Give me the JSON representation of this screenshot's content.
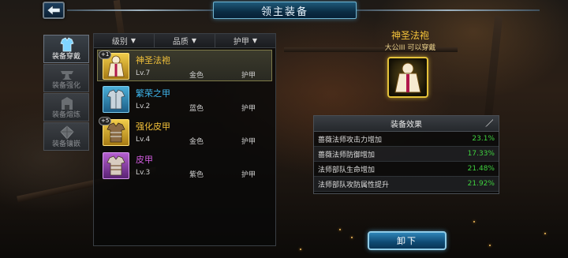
{
  "header": {
    "title": "领主装备",
    "back_icon": "back-arrow-icon"
  },
  "side_tabs": [
    {
      "label": "装备穿戴",
      "icon": "armor-icon",
      "active": true
    },
    {
      "label": "装备强化",
      "icon": "anvil-icon",
      "active": false
    },
    {
      "label": "装备熔炼",
      "icon": "furnace-icon",
      "active": false
    },
    {
      "label": "装备镶嵌",
      "icon": "gem-icon",
      "active": false
    }
  ],
  "filters": [
    {
      "label": "级别",
      "icon": "dropdown-triangle-icon"
    },
    {
      "label": "品质",
      "icon": "dropdown-triangle-icon"
    },
    {
      "label": "护甲",
      "icon": "dropdown-triangle-icon"
    }
  ],
  "items": [
    {
      "name": "神圣法袍",
      "level": "Lv.7",
      "quality": "金色",
      "type": "护甲",
      "badge": "+1",
      "color": "#f3c23a",
      "frame": "gold",
      "selected": true
    },
    {
      "name": "繁荣之甲",
      "level": "Lv.2",
      "quality": "蓝色",
      "type": "护甲",
      "badge": "",
      "color": "#3fb7ee",
      "frame": "blue",
      "selected": false
    },
    {
      "name": "强化皮甲",
      "level": "Lv.4",
      "quality": "金色",
      "type": "护甲",
      "badge": "+5",
      "color": "#f3c23a",
      "frame": "gold",
      "selected": false
    },
    {
      "name": "皮甲",
      "level": "Lv.3",
      "quality": "紫色",
      "type": "护甲",
      "badge": "",
      "color": "#d25ce0",
      "frame": "purple",
      "selected": false
    }
  ],
  "detail": {
    "name": "神圣法袍",
    "requirement": "大公III 可以穿戴",
    "icon": "holy-robe-icon",
    "effects_title": "装备效果",
    "effects": [
      {
        "label": "蔷薇法师攻击力增加",
        "value": "23.1%"
      },
      {
        "label": "蔷薇法师防御增加",
        "value": "17.33%"
      },
      {
        "label": "法师部队生命增加",
        "value": "21.48%"
      },
      {
        "label": "法师部队攻防属性提升",
        "value": "21.92%"
      }
    ],
    "unequip_label": "卸下"
  },
  "colors": {
    "gold": "#f3c23a",
    "blue": "#3fb7ee",
    "purple": "#d25ce0",
    "effect_value": "#3fd13f"
  }
}
